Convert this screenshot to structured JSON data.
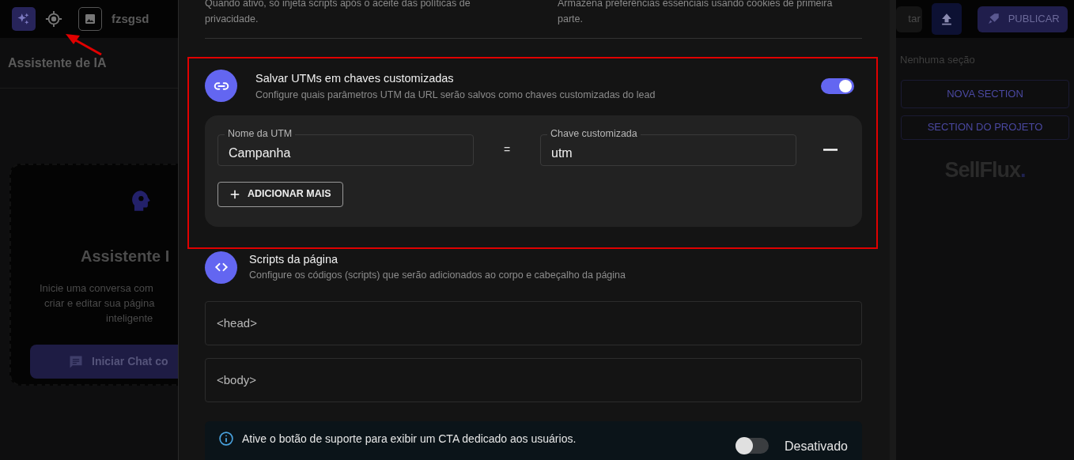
{
  "topbar": {
    "brand": "fzsgsd",
    "partial_button": "tar",
    "publish_button": "PUBLICAR"
  },
  "assistant_panel": {
    "header": "Assistente de IA",
    "card_title": "Assistente I",
    "card_text_lines": [
      "Inicie uma conversa com",
      "criar e editar sua página",
      "inteligente"
    ],
    "chat_button": "Iniciar Chat co"
  },
  "sections_panel": {
    "empty_text": "Nenhuma seção",
    "buttons": [
      "NOVA SECTION",
      "SECTION DO PROJETO"
    ],
    "logo": "SellFlux",
    "logo_mark": "."
  },
  "modal": {
    "consent_notes": [
      "Quando ativo, só injeta scripts após o aceite das políticas de privacidade.",
      "Armazena preferências essenciais usando cookies de primeira parte."
    ],
    "utm_section": {
      "title": "Salvar UTMs em chaves customizadas",
      "description": "Configure quais parâmetros UTM da URL serão salvos como chaves customizadas do lead",
      "enabled": true,
      "mappings": [
        {
          "utm_label": "Nome da UTM",
          "utm_value": "Campanha",
          "separator": "=",
          "key_label": "Chave customizada",
          "key_value": "utm"
        }
      ],
      "add_button": "ADICIONAR MAIS"
    },
    "scripts_section": {
      "title": "Scripts da página",
      "description": "Configure os códigos (scripts) que serão adicionados ao corpo e cabeçalho da página",
      "fields": [
        {
          "placeholder": "<head>"
        },
        {
          "placeholder": "<body>"
        }
      ]
    },
    "support_alert": {
      "text": "Ative o botão de suporte para exibir um CTA dedicado aos usuários.",
      "enabled": false,
      "status": "Desativado"
    }
  }
}
